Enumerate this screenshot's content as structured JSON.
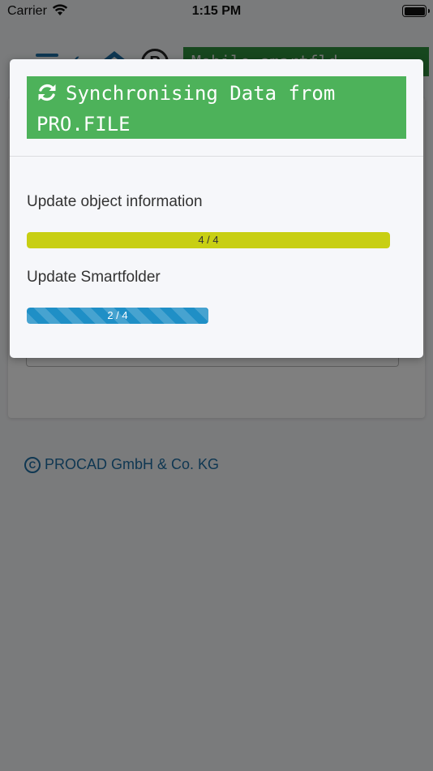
{
  "status_bar": {
    "carrier": "Carrier",
    "time": "1:15 PM"
  },
  "app": {
    "header_badge": "Mobile smartfld",
    "p_icon_letter": "P",
    "copyright": "PROCAD GmbH & Co. KG"
  },
  "modal": {
    "title": "Synchronising Data from PRO.FILE",
    "steps": [
      {
        "label": "Update object information",
        "progress_text": "4 / 4",
        "progress_fraction": 1.0,
        "color": "#c8cf13"
      },
      {
        "label": "Update Smartfolder",
        "progress_text": "2 / 4",
        "progress_fraction": 0.5,
        "color": "#1f8fc6"
      }
    ]
  },
  "colors": {
    "title_bg": "#4db25a",
    "brand_blue": "#1f6fa5"
  },
  "icons": {
    "sync": "sync-icon",
    "wifi": "wifi-icon",
    "battery": "battery-icon",
    "menu": "menu-icon",
    "home": "home-icon",
    "copyright": "copyright-icon"
  }
}
